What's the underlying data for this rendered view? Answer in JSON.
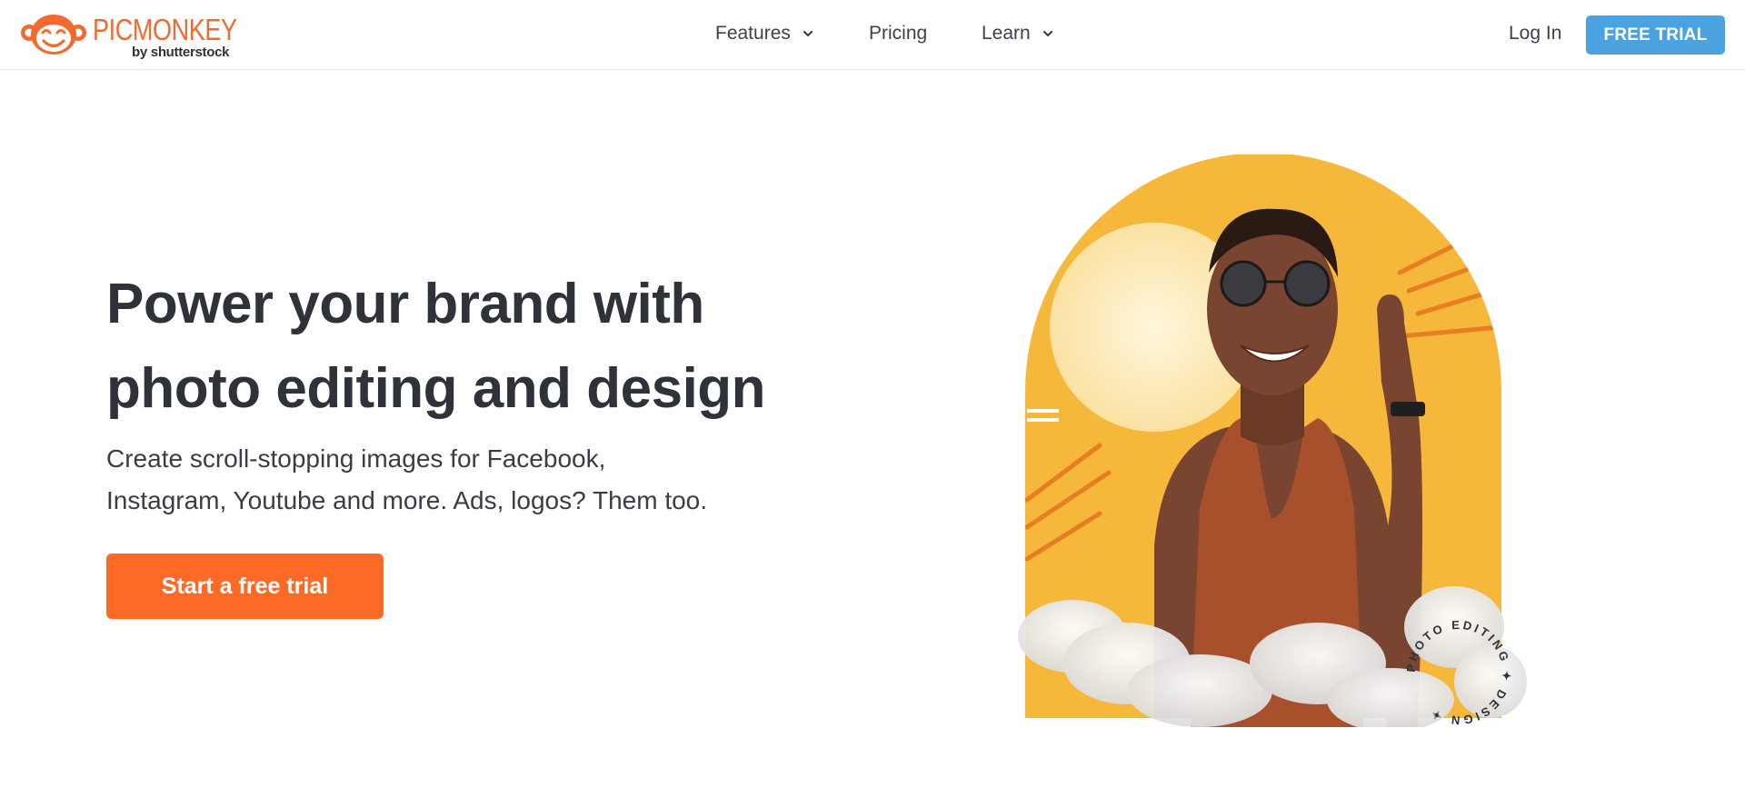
{
  "header": {
    "logo": {
      "wordmark": "PICMONKEY",
      "byline": "by shutterstock"
    },
    "nav": [
      {
        "label": "Features",
        "has_dropdown": true
      },
      {
        "label": "Pricing",
        "has_dropdown": false
      },
      {
        "label": "Learn",
        "has_dropdown": true
      }
    ],
    "login_label": "Log In",
    "free_trial_label": "FREE TRIAL"
  },
  "hero": {
    "title_line1": "Power your brand with",
    "title_line2": "photo editing and design",
    "subtitle_line1": "Create scroll-stopping images for Facebook,",
    "subtitle_line2": "Instagram, Youtube and more. Ads, logos? Them too.",
    "cta_label": "Start a free trial",
    "badge_text": "PHOTO EDITING ✦ DESIGN ✦"
  },
  "colors": {
    "brand_orange": "#f26a2e",
    "cta_orange": "#fd6a25",
    "trial_blue": "#4aa3e0",
    "text_dark": "#2f3238",
    "arch_yellow": "#f6b83a"
  },
  "icons": {
    "logo": "monkey-face-icon",
    "dropdown": "chevron-down-icon"
  }
}
